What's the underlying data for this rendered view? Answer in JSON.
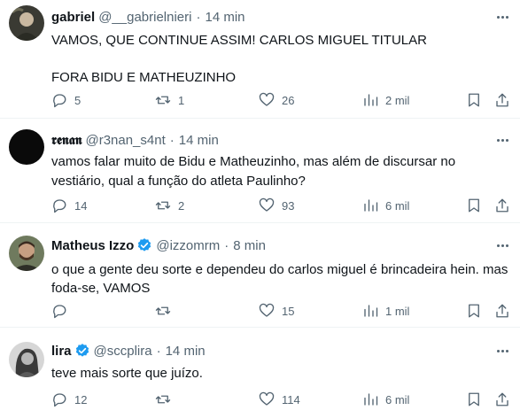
{
  "tweets": [
    {
      "name": "gabriel",
      "handle": "@__gabrielnieri",
      "sep": "·",
      "time": "14 min",
      "text": "VAMOS, QUE CONTINUE ASSIM! CARLOS MIGUEL TITULAR\n\nFORA BIDU E MATHEUZINHO",
      "replies": "5",
      "reposts": "1",
      "likes": "26",
      "views": "2 mil",
      "verified": false
    },
    {
      "name": "𝖗𝖊𝖓𝖆𝖓",
      "handle": "@r3nan_s4nt",
      "sep": "·",
      "time": "14 min",
      "text": "vamos falar muito de Bidu e Matheuzinho, mas além de discursar no vestiário, qual a função do atleta Paulinho?",
      "replies": "14",
      "reposts": "2",
      "likes": "93",
      "views": "6 mil",
      "verified": false
    },
    {
      "name": "Matheus Izzo",
      "handle": "@izzomrm",
      "sep": "·",
      "time": "8 min",
      "text": "o que a gente deu sorte e dependeu do carlos miguel é brincadeira hein. mas foda-se, VAMOS",
      "replies": "",
      "reposts": "",
      "likes": "15",
      "views": "1 mil",
      "verified": true
    },
    {
      "name": "lira",
      "handle": "@sccplira",
      "sep": "·",
      "time": "14 min",
      "text": "teve mais sorte que juízo.",
      "replies": "12",
      "reposts": "",
      "likes": "114",
      "views": "6 mil",
      "verified": true
    }
  ],
  "colors": {
    "text_primary": "#0f1419",
    "text_secondary": "#536471",
    "divider": "#eff3f4",
    "verified_blue": "#1d9bf0"
  },
  "icons": [
    "reply-icon",
    "repost-icon",
    "like-icon",
    "views-icon",
    "bookmark-icon",
    "share-icon",
    "more-icon",
    "verified-badge-icon"
  ]
}
